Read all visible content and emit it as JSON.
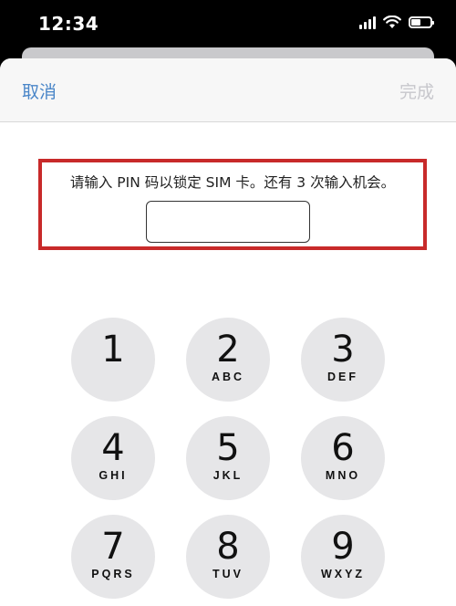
{
  "status_bar": {
    "time": "12:34"
  },
  "nav": {
    "cancel_label": "取消",
    "done_label": "完成"
  },
  "pin": {
    "prompt": "请输入 PIN 码以锁定 SIM 卡。还有 3 次输入机会。",
    "value": ""
  },
  "keypad": {
    "keys": [
      {
        "digit": "1",
        "letters": ""
      },
      {
        "digit": "2",
        "letters": "ABC"
      },
      {
        "digit": "3",
        "letters": "DEF"
      },
      {
        "digit": "4",
        "letters": "GHI"
      },
      {
        "digit": "5",
        "letters": "JKL"
      },
      {
        "digit": "6",
        "letters": "MNO"
      },
      {
        "digit": "7",
        "letters": "PQRS"
      },
      {
        "digit": "8",
        "letters": "TUV"
      },
      {
        "digit": "9",
        "letters": "WXYZ"
      }
    ]
  },
  "colors": {
    "accent": "#4a86c8",
    "highlight_border": "#c82a2a",
    "key_background": "#e6e6e8",
    "disabled_text": "#c7c7cc"
  }
}
